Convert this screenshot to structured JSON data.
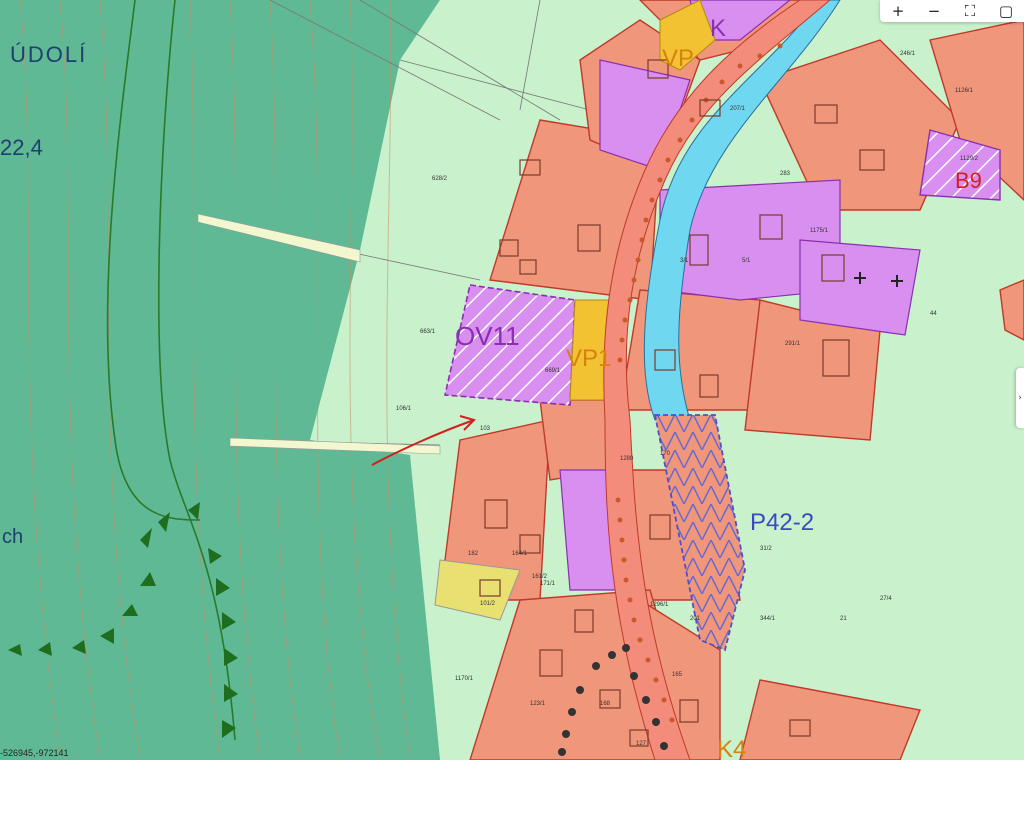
{
  "map": {
    "labels": {
      "udoli": "ÚDOLÍ",
      "elev": "22,4",
      "ch": "ch",
      "ov11": "OV11",
      "vp1": "VP1",
      "vp_top": "VP",
      "k_top": "K",
      "b9": "B9",
      "p42_2": "P42-2",
      "k4": "K4"
    },
    "parcel_numbers": [
      "663/1",
      "628/2",
      "669/1",
      "103",
      "106/1",
      "101/2",
      "182",
      "164/1",
      "161/2",
      "170",
      "171/1",
      "1170/1",
      "1280",
      "127",
      "123/1",
      "246/1",
      "283",
      "291/1",
      "344/1",
      "201",
      "207/1",
      "3/1",
      "5/1",
      "1126/1",
      "1129/2",
      "1296/1",
      "1175/1",
      "44",
      "21",
      "31/2",
      "27/4",
      "168",
      "165"
    ],
    "coordinates": "-526945,-972141"
  },
  "toolbar": {
    "zoom_in": "+",
    "zoom_out": "−",
    "fullscreen": "⛶",
    "layers": "▢"
  },
  "side_handle": "›",
  "colors": {
    "forest": "#5cba92",
    "meadow": "#c8f0c8",
    "residential": "#f0957a",
    "civic": "#d98fef",
    "transport": "#f2c230",
    "river": "#6dd8f0",
    "road": "#f48c7c",
    "boundary": "#c0392b"
  }
}
